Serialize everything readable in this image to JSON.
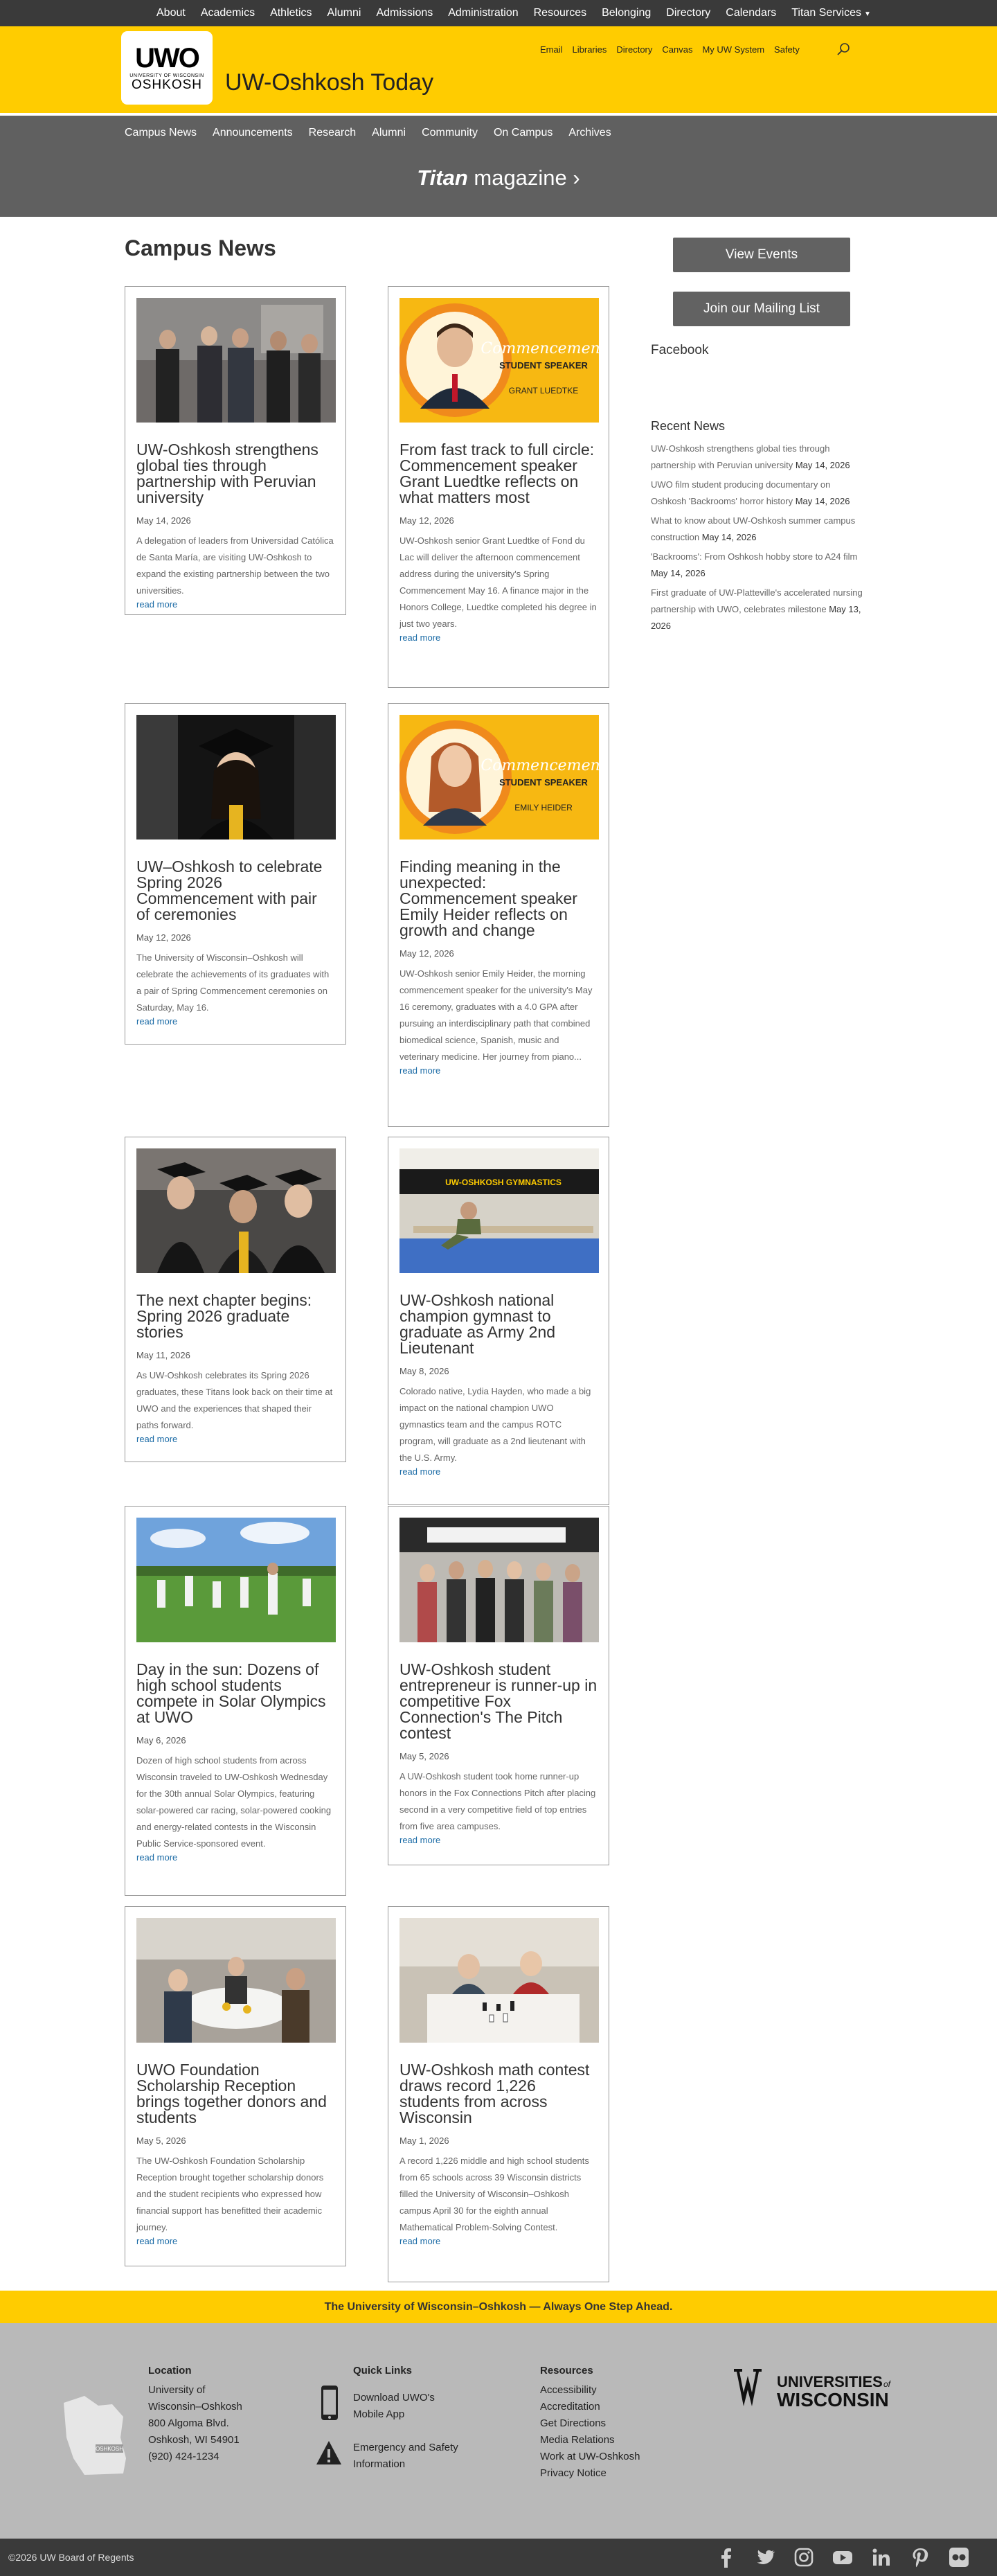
{
  "top_nav": [
    "About",
    "Academics",
    "Athletics",
    "Alumni",
    "Admissions",
    "Administration",
    "Resources",
    "Belonging",
    "Directory",
    "Calendars",
    "Titan Services"
  ],
  "logo": {
    "mark": "UWO",
    "university": "UNIVERSITY OF WISCONSIN",
    "campus": "OSHKOSH"
  },
  "site_title": "UW-Oshkosh Today",
  "utility_links": [
    "Email",
    "Libraries",
    "Directory",
    "Canvas",
    "My UW System",
    "Safety"
  ],
  "sub_nav": [
    "Campus News",
    "Announcements",
    "Research",
    "Alumni",
    "Community",
    "On Campus",
    "Archives"
  ],
  "titan": {
    "brand": "Titan",
    "rest": " magazine ›"
  },
  "section_title": "Campus News",
  "read_more": "read more",
  "articles": [
    {
      "title": "UW-Oshkosh strengthens global ties through partnership with Peruvian university",
      "date": "May 14, 2026",
      "excerpt": "A delegation of leaders from Universidad Católica de Santa María, are visiting UW-Oshkosh to expand the existing partnership between the two universities.",
      "image": "photo-delegation-meeting"
    },
    {
      "title": "From fast track to full circle: Commencement speaker Grant Luedtke reflects on what matters most",
      "date": "May 12, 2026",
      "excerpt": "UW-Oshkosh senior Grant Luedtke of Fond du Lac will deliver the afternoon commencement address during the university's Spring Commencement May 16. A finance major in the Honors College, Luedtke completed his degree in just two years.",
      "image": "graphic-commencement-speaker",
      "graphic": {
        "script": "Commencement",
        "label": "STUDENT SPEAKER",
        "name": "GRANT LUEDTKE"
      }
    },
    {
      "title": "UW–Oshkosh to celebrate Spring 2026 Commencement with pair of ceremonies",
      "date": "May 12, 2026",
      "excerpt": "The University of Wisconsin–Oshkosh will celebrate the achievements of its graduates with a pair of Spring Commencement ceremonies on Saturday, May 16.",
      "image": "photo-graduate-cap"
    },
    {
      "title": "Finding meaning in the unexpected: Commencement speaker Emily Heider reflects on growth and change",
      "date": "May 12, 2026",
      "excerpt": " UW-Oshkosh senior Emily Heider, the morning commencement speaker for the university's May 16 ceremony, graduates with a 4.0 GPA after pursuing an interdisciplinary path that combined biomedical science, Spanish, music and veterinary medicine. Her journey from piano...",
      "image": "graphic-commencement-speaker",
      "graphic": {
        "script": "Commencement",
        "label": "STUDENT SPEAKER",
        "name": "EMILY HEIDER"
      }
    },
    {
      "title": "The next chapter begins: Spring 2026 graduate stories",
      "date": "May 11, 2026",
      "excerpt": "As UW-Oshkosh celebrates its Spring 2026 graduates, these Titans look back on their time at UWO and the experiences that shaped their paths forward.",
      "image": "photo-graduates-group"
    },
    {
      "title": "UW-Oshkosh national champion gymnast to graduate as Army 2nd Lieutenant",
      "date": "May 8, 2026",
      "excerpt": "Colorado native, Lydia Hayden, who made a big impact on the national champion UWO gymnastics team and the campus ROTC program, will graduate as a 2nd lieutenant with the U.S. Army.",
      "image": "photo-gymnast-beam",
      "banner": "UW-OSHKOSH GYMNASTICS"
    },
    {
      "title": "Day in the sun: Dozens of high school students compete in Solar Olympics at UWO",
      "date": "May 6, 2026",
      "excerpt": "Dozen of high school students from across Wisconsin traveled to UW-Oshkosh Wednesday for the 30th annual Solar Olympics, featuring solar-powered car racing, solar-powered cooking and energy-related contests in the Wisconsin Public Service-sponsored event.",
      "image": "photo-solar-olympics"
    },
    {
      "title": "UW-Oshkosh student entrepreneur is runner-up in competitive Fox Connection's The Pitch contest",
      "date": "May 5, 2026",
      "excerpt": "A UW-Oshkosh student took home runner-up honors in the Fox Connections Pitch after placing second in a very competitive field of top entries from five area campuses.",
      "image": "photo-pitch-contest"
    },
    {
      "title": "UWO Foundation Scholarship Reception brings together donors and students",
      "date": "May 5, 2026",
      "excerpt": "The UW-Oshkosh Foundation Scholarship Reception brought together scholarship donors and the student recipients who expressed how financial support has benefitted their academic journey.",
      "image": "photo-scholarship-reception"
    },
    {
      "title": "UW-Oshkosh math contest draws record 1,226 students from across Wisconsin",
      "date": "May 1, 2026",
      "excerpt": "A record 1,226 middle and high school students from 65 schools across 39 Wisconsin districts filled the University of Wisconsin–Oshkosh campus April 30 for the eighth annual Mathematical Problem-Solving Contest.",
      "image": "photo-math-contest"
    }
  ],
  "sidebar": {
    "view_events": "View Events",
    "mailing_list": "Join our Mailing List",
    "facebook": "Facebook",
    "recent_title": "Recent News",
    "recent": [
      {
        "title": "UW-Oshkosh strengthens global ties through partnership with Peruvian university",
        "date": " May 14, 2026"
      },
      {
        "title": "UWO film student producing documentary on Oshkosh 'Backrooms' horror history",
        "date": " May 14, 2026"
      },
      {
        "title": "What to know about UW-Oshkosh summer campus construction",
        "date": " May 14, 2026"
      },
      {
        "title": "'Backrooms': From Oshkosh hobby store to A24 film",
        "date": " May 14, 2026"
      },
      {
        "title": "First graduate of UW-Platteville's accelerated nursing partnership with UWO, celebrates milestone",
        "date": " May 13, 2026"
      }
    ]
  },
  "tagline": "The University of Wisconsin–Oshkosh — Always One Step Ahead.",
  "footer": {
    "location_title": "Location",
    "address": [
      "University of",
      "Wisconsin–Oshkosh",
      "800 Algoma Blvd.",
      "Oshkosh, WI 54901",
      "(920) 424-1234"
    ],
    "map_label": "OSHKOSH",
    "quick_title": "Quick Links",
    "quick": [
      [
        "Download UWO's",
        "Mobile App"
      ],
      [
        "Emergency and Safety",
        "Information"
      ]
    ],
    "resources_title": "Resources",
    "resources": [
      "Accessibility",
      "Accreditation",
      "Get Directions",
      "Media Relations",
      "Work at UW-Oshkosh",
      "Privacy Notice"
    ],
    "uw_logo": {
      "line1": "UNIVERSITIES",
      "of": "of",
      "line2": "WISCONSIN"
    }
  },
  "copyright": "©2026 UW Board of Regents",
  "socials": [
    "facebook-icon",
    "twitter-icon",
    "instagram-icon",
    "youtube-icon",
    "linkedin-icon",
    "pinterest-icon",
    "flickr-icon"
  ],
  "colors": {
    "gold": "#ffcc00",
    "dark": "#3a3a3a",
    "link": "#1b6ba6"
  }
}
